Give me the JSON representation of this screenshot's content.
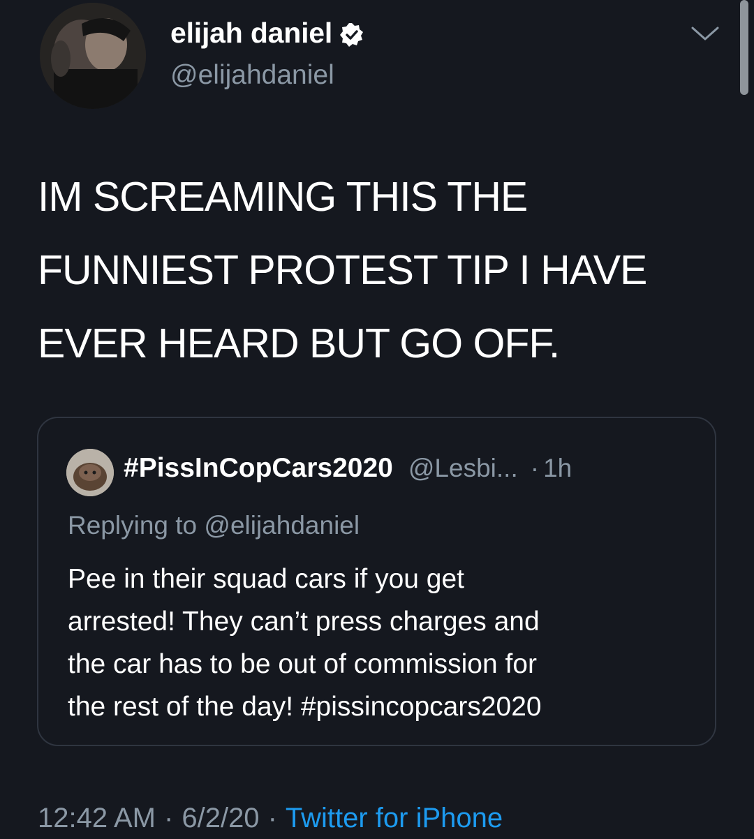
{
  "author": {
    "display_name": "elijah daniel",
    "handle": "@elijahdaniel",
    "verified_icon": "verified-badge-icon"
  },
  "tweet": {
    "text": "IM SCREAMING THIS THE\nFUNNIEST PROTEST TIP I HAVE\nEVER HEARD BUT GO OFF."
  },
  "quoted_tweet": {
    "display_name": "#PissInCopCars2020",
    "handle": "@Lesbi...",
    "dot": "·",
    "time": "1h",
    "replying_to": "Replying to @elijahdaniel",
    "text": "Pee in their squad cars if you get\narrested! They can’t press charges and\nthe car has to be out of commission for\nthe rest of the day! #pissincopcars2020"
  },
  "footer": {
    "time": "12:42 AM",
    "separator": "·",
    "date": "6/2/20",
    "source": "Twitter for iPhone"
  },
  "colors": {
    "background": "#15181f",
    "muted_text": "#8b98a5",
    "link_blue": "#1d9bf0",
    "card_border": "#2f3540"
  }
}
